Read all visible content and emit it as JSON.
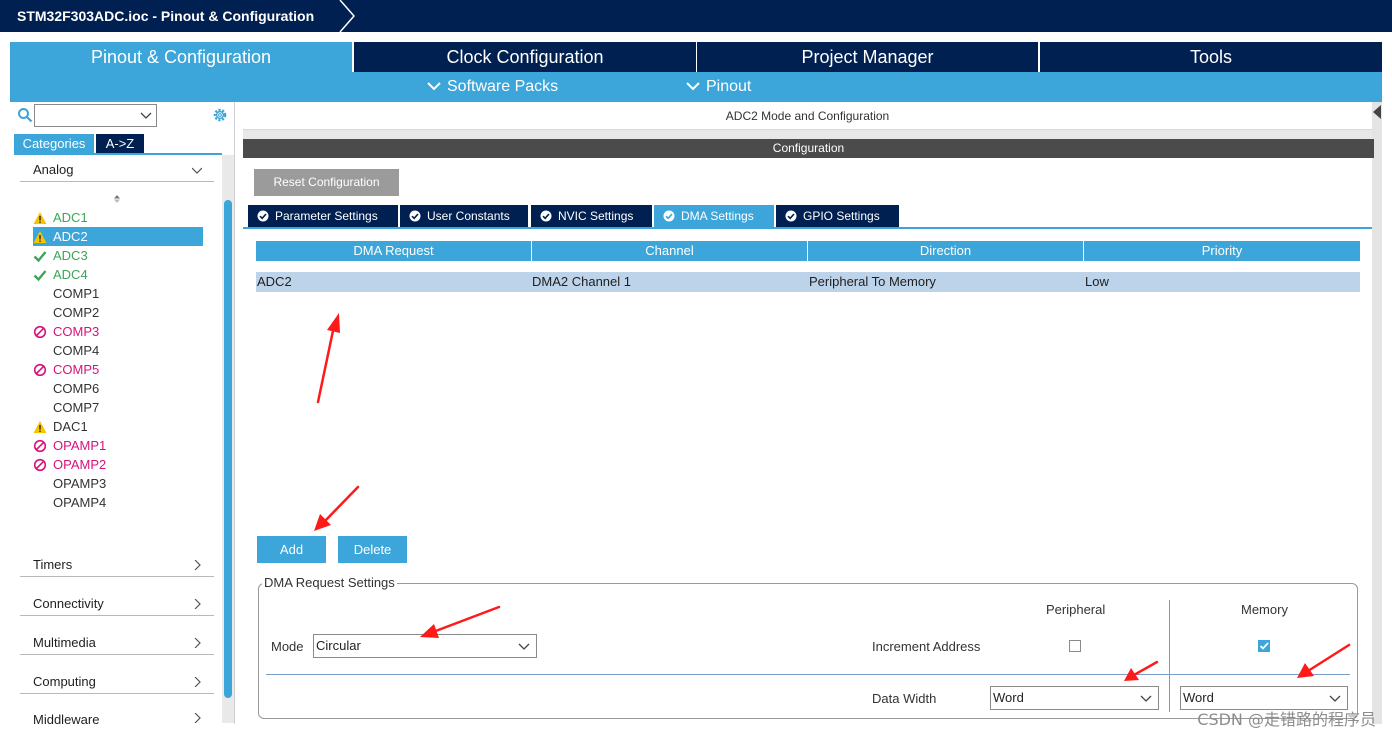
{
  "window": {
    "title": "STM32F303ADC.ioc - Pinout & Configuration"
  },
  "main_tabs": [
    {
      "label": "Pinout & Configuration",
      "active": true
    },
    {
      "label": "Clock Configuration",
      "active": false
    },
    {
      "label": "Project Manager",
      "active": false
    },
    {
      "label": "Tools",
      "active": false
    }
  ],
  "sub_menu": [
    {
      "label": "Software Packs"
    },
    {
      "label": "Pinout"
    }
  ],
  "sidebar": {
    "search": {
      "value": ""
    },
    "tabs": [
      {
        "label": "Categories",
        "active": true
      },
      {
        "label": "A->Z",
        "active": false
      }
    ],
    "categories": [
      {
        "label": "Analog",
        "expanded": true
      },
      {
        "label": "Timers",
        "expanded": false
      },
      {
        "label": "Connectivity",
        "expanded": false
      },
      {
        "label": "Multimedia",
        "expanded": false
      },
      {
        "label": "Computing",
        "expanded": false
      },
      {
        "label": "Middleware",
        "expanded": false
      }
    ],
    "analog_items": [
      {
        "label": "ADC1",
        "status": "warning",
        "selected": false
      },
      {
        "label": "ADC2",
        "status": "warning",
        "selected": true
      },
      {
        "label": "ADC3",
        "status": "ok",
        "selected": false
      },
      {
        "label": "ADC4",
        "status": "ok",
        "selected": false
      },
      {
        "label": "COMP1",
        "status": "none",
        "selected": false
      },
      {
        "label": "COMP2",
        "status": "none",
        "selected": false
      },
      {
        "label": "COMP3",
        "status": "blocked",
        "selected": false
      },
      {
        "label": "COMP4",
        "status": "none",
        "selected": false
      },
      {
        "label": "COMP5",
        "status": "blocked",
        "selected": false
      },
      {
        "label": "COMP6",
        "status": "none",
        "selected": false
      },
      {
        "label": "COMP7",
        "status": "none",
        "selected": false
      },
      {
        "label": "DAC1",
        "status": "warning",
        "selected": false
      },
      {
        "label": "OPAMP1",
        "status": "blocked",
        "selected": false
      },
      {
        "label": "OPAMP2",
        "status": "blocked",
        "selected": false
      },
      {
        "label": "OPAMP3",
        "status": "none",
        "selected": false
      },
      {
        "label": "OPAMP4",
        "status": "none",
        "selected": false
      }
    ]
  },
  "main": {
    "mode_title": "ADC2 Mode and Configuration",
    "config_title": "Configuration",
    "reset_label": "Reset Configuration",
    "config_tabs": [
      {
        "label": "Parameter Settings",
        "active": false
      },
      {
        "label": "User Constants",
        "active": false
      },
      {
        "label": "NVIC Settings",
        "active": false
      },
      {
        "label": "DMA Settings",
        "active": true
      },
      {
        "label": "GPIO Settings",
        "active": false
      }
    ],
    "dma_table": {
      "columns": [
        "DMA Request",
        "Channel",
        "Direction",
        "Priority"
      ],
      "rows": [
        [
          "ADC2",
          "DMA2 Channel 1",
          "Peripheral To Memory",
          "Low"
        ]
      ]
    },
    "add_label": "Add",
    "delete_label": "Delete",
    "request_settings": {
      "legend": "DMA Request Settings",
      "peripheral_header": "Peripheral",
      "memory_header": "Memory",
      "mode_label": "Mode",
      "mode_value": "Circular",
      "increment_label": "Increment Address",
      "increment_peripheral": false,
      "increment_memory": true,
      "data_width_label": "Data Width",
      "peripheral_width": "Word",
      "memory_width": "Word"
    }
  },
  "watermark": "CSDN @走错路的程序员",
  "colors": {
    "navy": "#002052",
    "accent": "#3ca5d9",
    "warning": "#f5c400",
    "ok": "#3aa757",
    "blocked": "#d6137a",
    "annotation": "#ff1a1a"
  }
}
